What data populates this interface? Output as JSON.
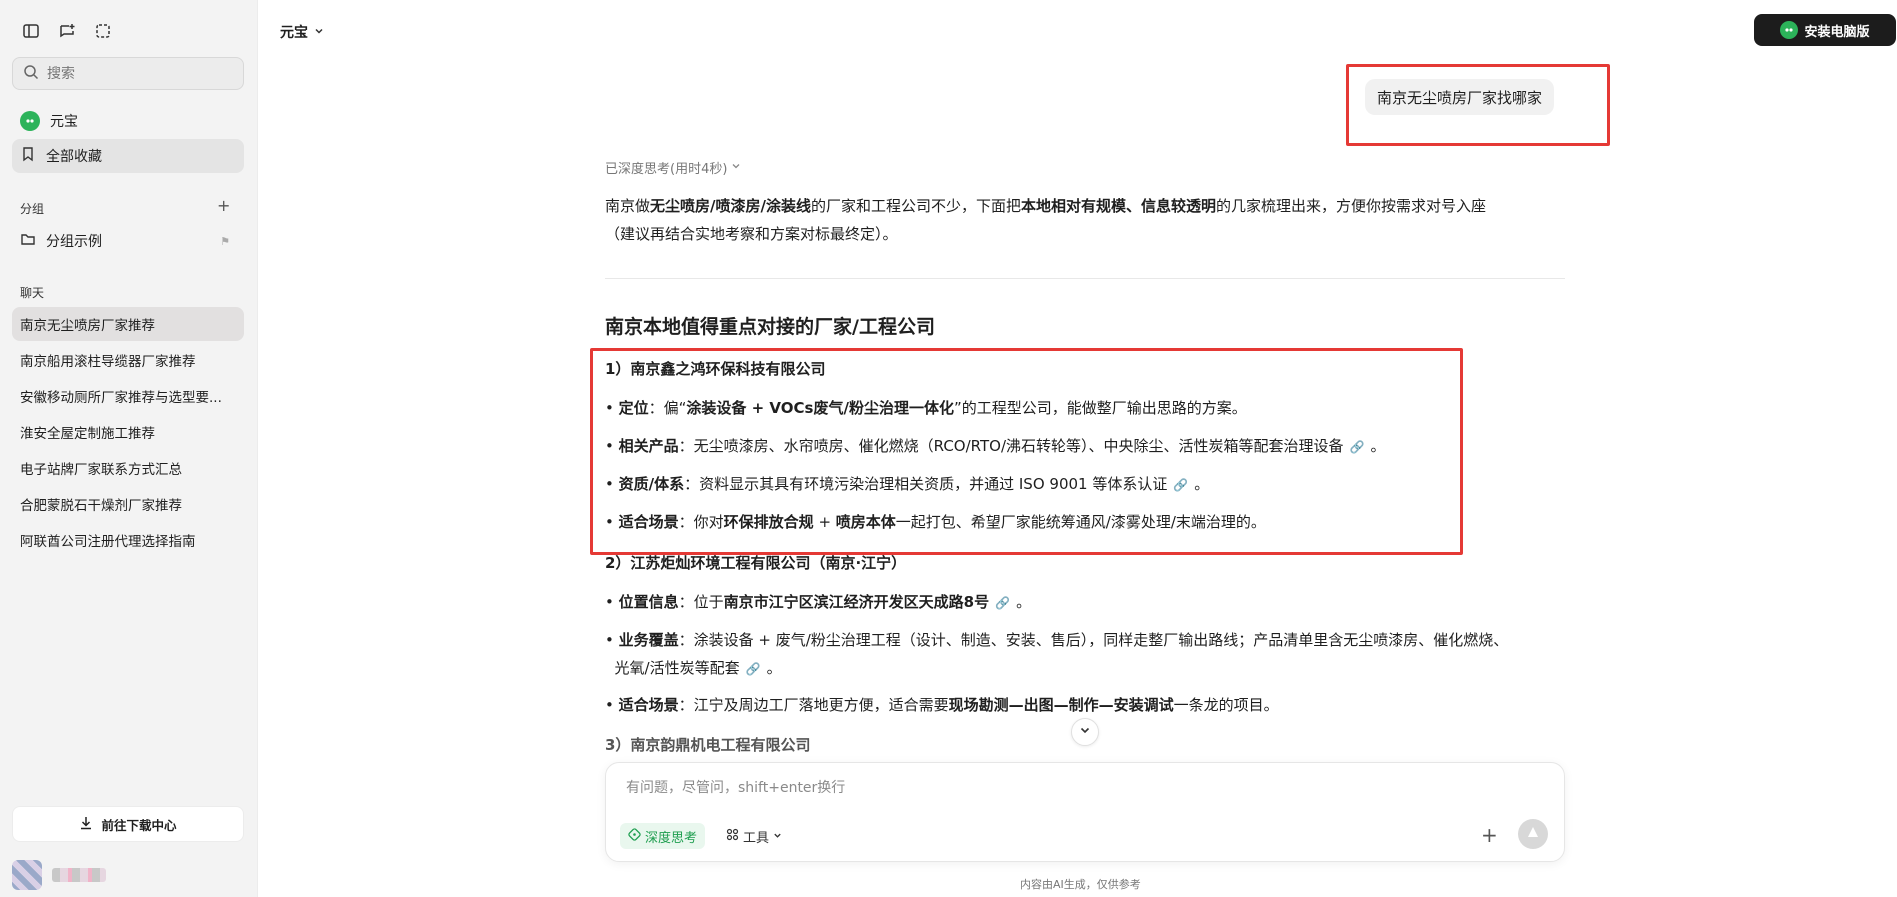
{
  "sidebar": {
    "search_placeholder": "搜索",
    "nav": [
      {
        "label": "元宝"
      },
      {
        "label": "全部收藏"
      }
    ],
    "group_section_label": "分组",
    "group_items": [
      {
        "label": "分组示例"
      }
    ],
    "chat_section_label": "聊天",
    "chats": [
      "南京无尘喷房厂家推荐",
      "南京船用滚柱导缆器厂家推荐",
      "安徽移动厕所厂家推荐与选型要...",
      "淮安全屋定制施工推荐",
      "电子站牌厂家联系方式汇总",
      "合肥蒙脱石干燥剂厂家推荐",
      "阿联酋公司注册代理选择指南"
    ],
    "download_label": "前往下载中心"
  },
  "header": {
    "title": "元宝",
    "install_label": "安装电脑版"
  },
  "conversation": {
    "user_message": "南京无尘喷房厂家找哪家",
    "thinking_label": "已深度思考(用时4秒)",
    "intro": {
      "t1": "南京做",
      "b1": "无尘喷房/喷漆房/涂装线",
      "t2": "的厂家和工程公司不少，下面把",
      "b2": "本地相对有规模、信息较透明",
      "t3": "的几家梳理出来，方便你按需求对号入座",
      "line2": "（建议再结合实地考察和方案对标最终定）。"
    },
    "heading": "南京本地值得重点对接的厂家/工程公司",
    "company1": {
      "title": "1）南京鑫之鸿环保科技有限公司",
      "b1_label": "定位",
      "b1_t1": "：偏“",
      "b1_bold": "涂装设备 + VOCs废气/粉尘治理一体化",
      "b1_t2": "”的工程型公司，能做整厂输出思路的方案。",
      "b2_label": "相关产品",
      "b2_text": "：无尘喷漆房、水帘喷房、催化燃烧（RCO/RTO/沸石转轮等）、中央除尘、活性炭箱等配套治理设备",
      "b3_label": "资质/体系",
      "b3_text": "：资料显示其具有环境污染治理相关资质，并通过 ISO 9001 等体系认证",
      "b4_label": "适合场景",
      "b4_t1": "：你对",
      "b4_bold1": "环保排放合规",
      "b4_t2": " + ",
      "b4_bold2": "喷房本体",
      "b4_t3": "一起打包、希望厂家能统筹通风/漆雾处理/末端治理的。"
    },
    "company2": {
      "title": "2）江苏炬灿环境工程有限公司（南京·江宁）",
      "b1_label": "位置信息",
      "b1_t1": "：位于",
      "b1_bold": "南京市江宁区滨江经济开发区天成路8号",
      "b2_label": "业务覆盖",
      "b2_line1": "：涂装设备 + 废气/粉尘治理工程（设计、制造、安装、售后），同样走整厂输出路线；产品清单里含无尘喷漆房、催化燃烧、",
      "b2_line2": "光氧/活性炭等配套",
      "b3_label": "适合场景",
      "b3_t1": "：江宁及周边工厂落地更方便，适合需要",
      "b3_bold": "现场勘测—出图—制作—安装调试",
      "b3_t2": "一条龙的项目。"
    },
    "company3": {
      "title": "3）南京韵鼎机电工程有限公司"
    },
    "period": "。"
  },
  "composer": {
    "placeholder": "有问题，尽管问，shift+enter换行",
    "deep_think_label": "深度思考",
    "tools_label": "工具"
  },
  "footer": {
    "disclaimer": "内容由AI生成，仅供参考"
  },
  "colors": {
    "accent_green": "#2cb35a",
    "highlight_red": "#e53935"
  }
}
